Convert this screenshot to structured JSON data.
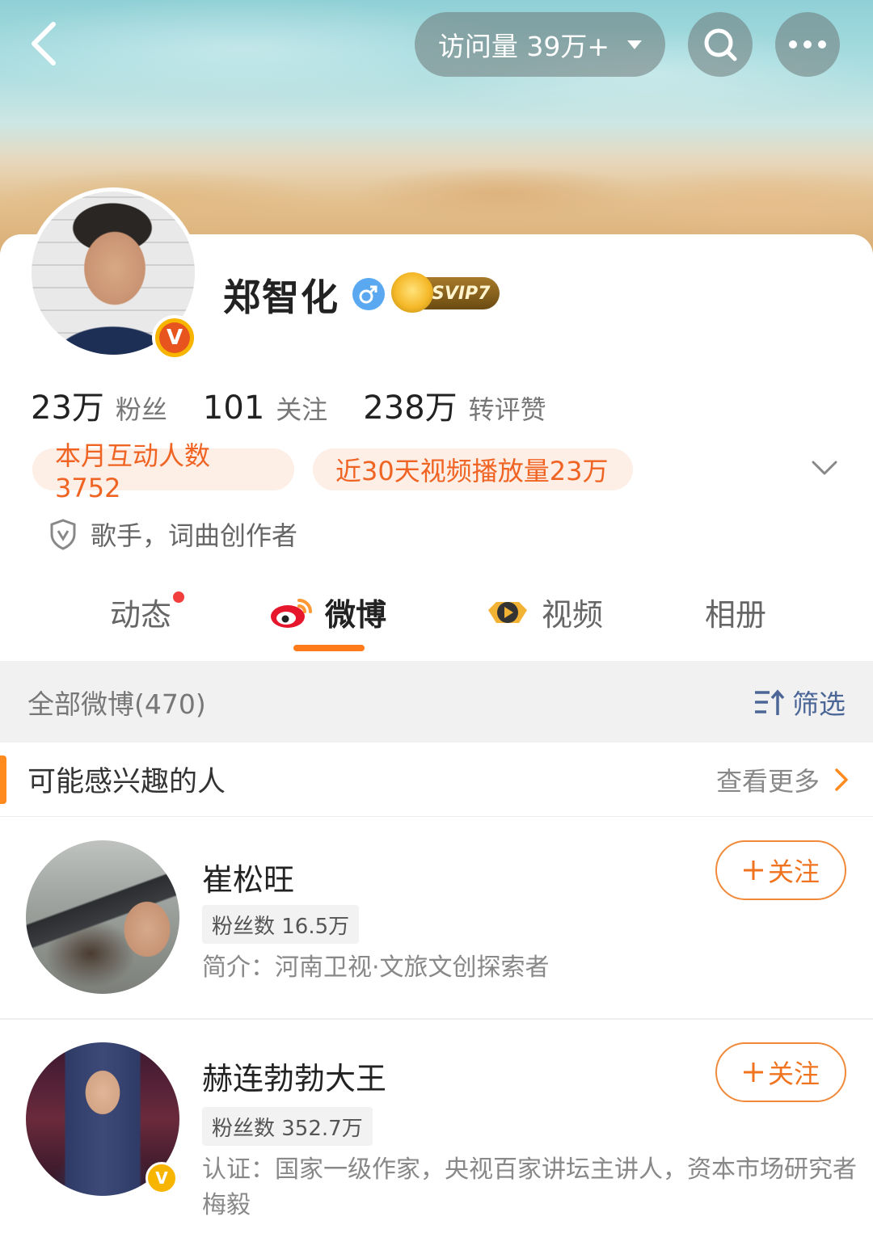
{
  "header": {
    "visits_label": "访问量 39万+"
  },
  "profile": {
    "name": "郑智化",
    "vip_badge": "SVIP7",
    "stats": [
      {
        "value": "23万",
        "label": "粉丝"
      },
      {
        "value": "101",
        "label": "关注"
      },
      {
        "value": "238万",
        "label": "转评赞"
      }
    ],
    "chips": [
      "本月互动人数3752",
      "近30天视频播放量23万"
    ],
    "description": "歌手，词曲创作者"
  },
  "tabs": [
    {
      "label": "动态",
      "has_dot": true
    },
    {
      "label": "微博",
      "active": true
    },
    {
      "label": "视频"
    },
    {
      "label": "相册"
    }
  ],
  "feed": {
    "all_label": "全部微博(470)",
    "filter_label": "筛选"
  },
  "recommend": {
    "title": "可能感兴趣的人",
    "see_more": "查看更多",
    "people": [
      {
        "name": "崔松旺",
        "fans": "粉丝数 16.5万",
        "intro": "简介：河南卫视·文旅文创探索者",
        "follow_label": "关注",
        "verified": false
      },
      {
        "name": "赫连勃勃大王",
        "fans": "粉丝数 352.7万",
        "intro": "认证：国家一级作家，央视百家讲坛主讲人，资本市场研究者梅毅",
        "follow_label": "关注",
        "verified": true
      }
    ]
  },
  "colors": {
    "accent": "#ff7a1a",
    "chip_text": "#f06423",
    "chip_bg": "#fdeee6",
    "filter_blue": "#4c6797"
  }
}
